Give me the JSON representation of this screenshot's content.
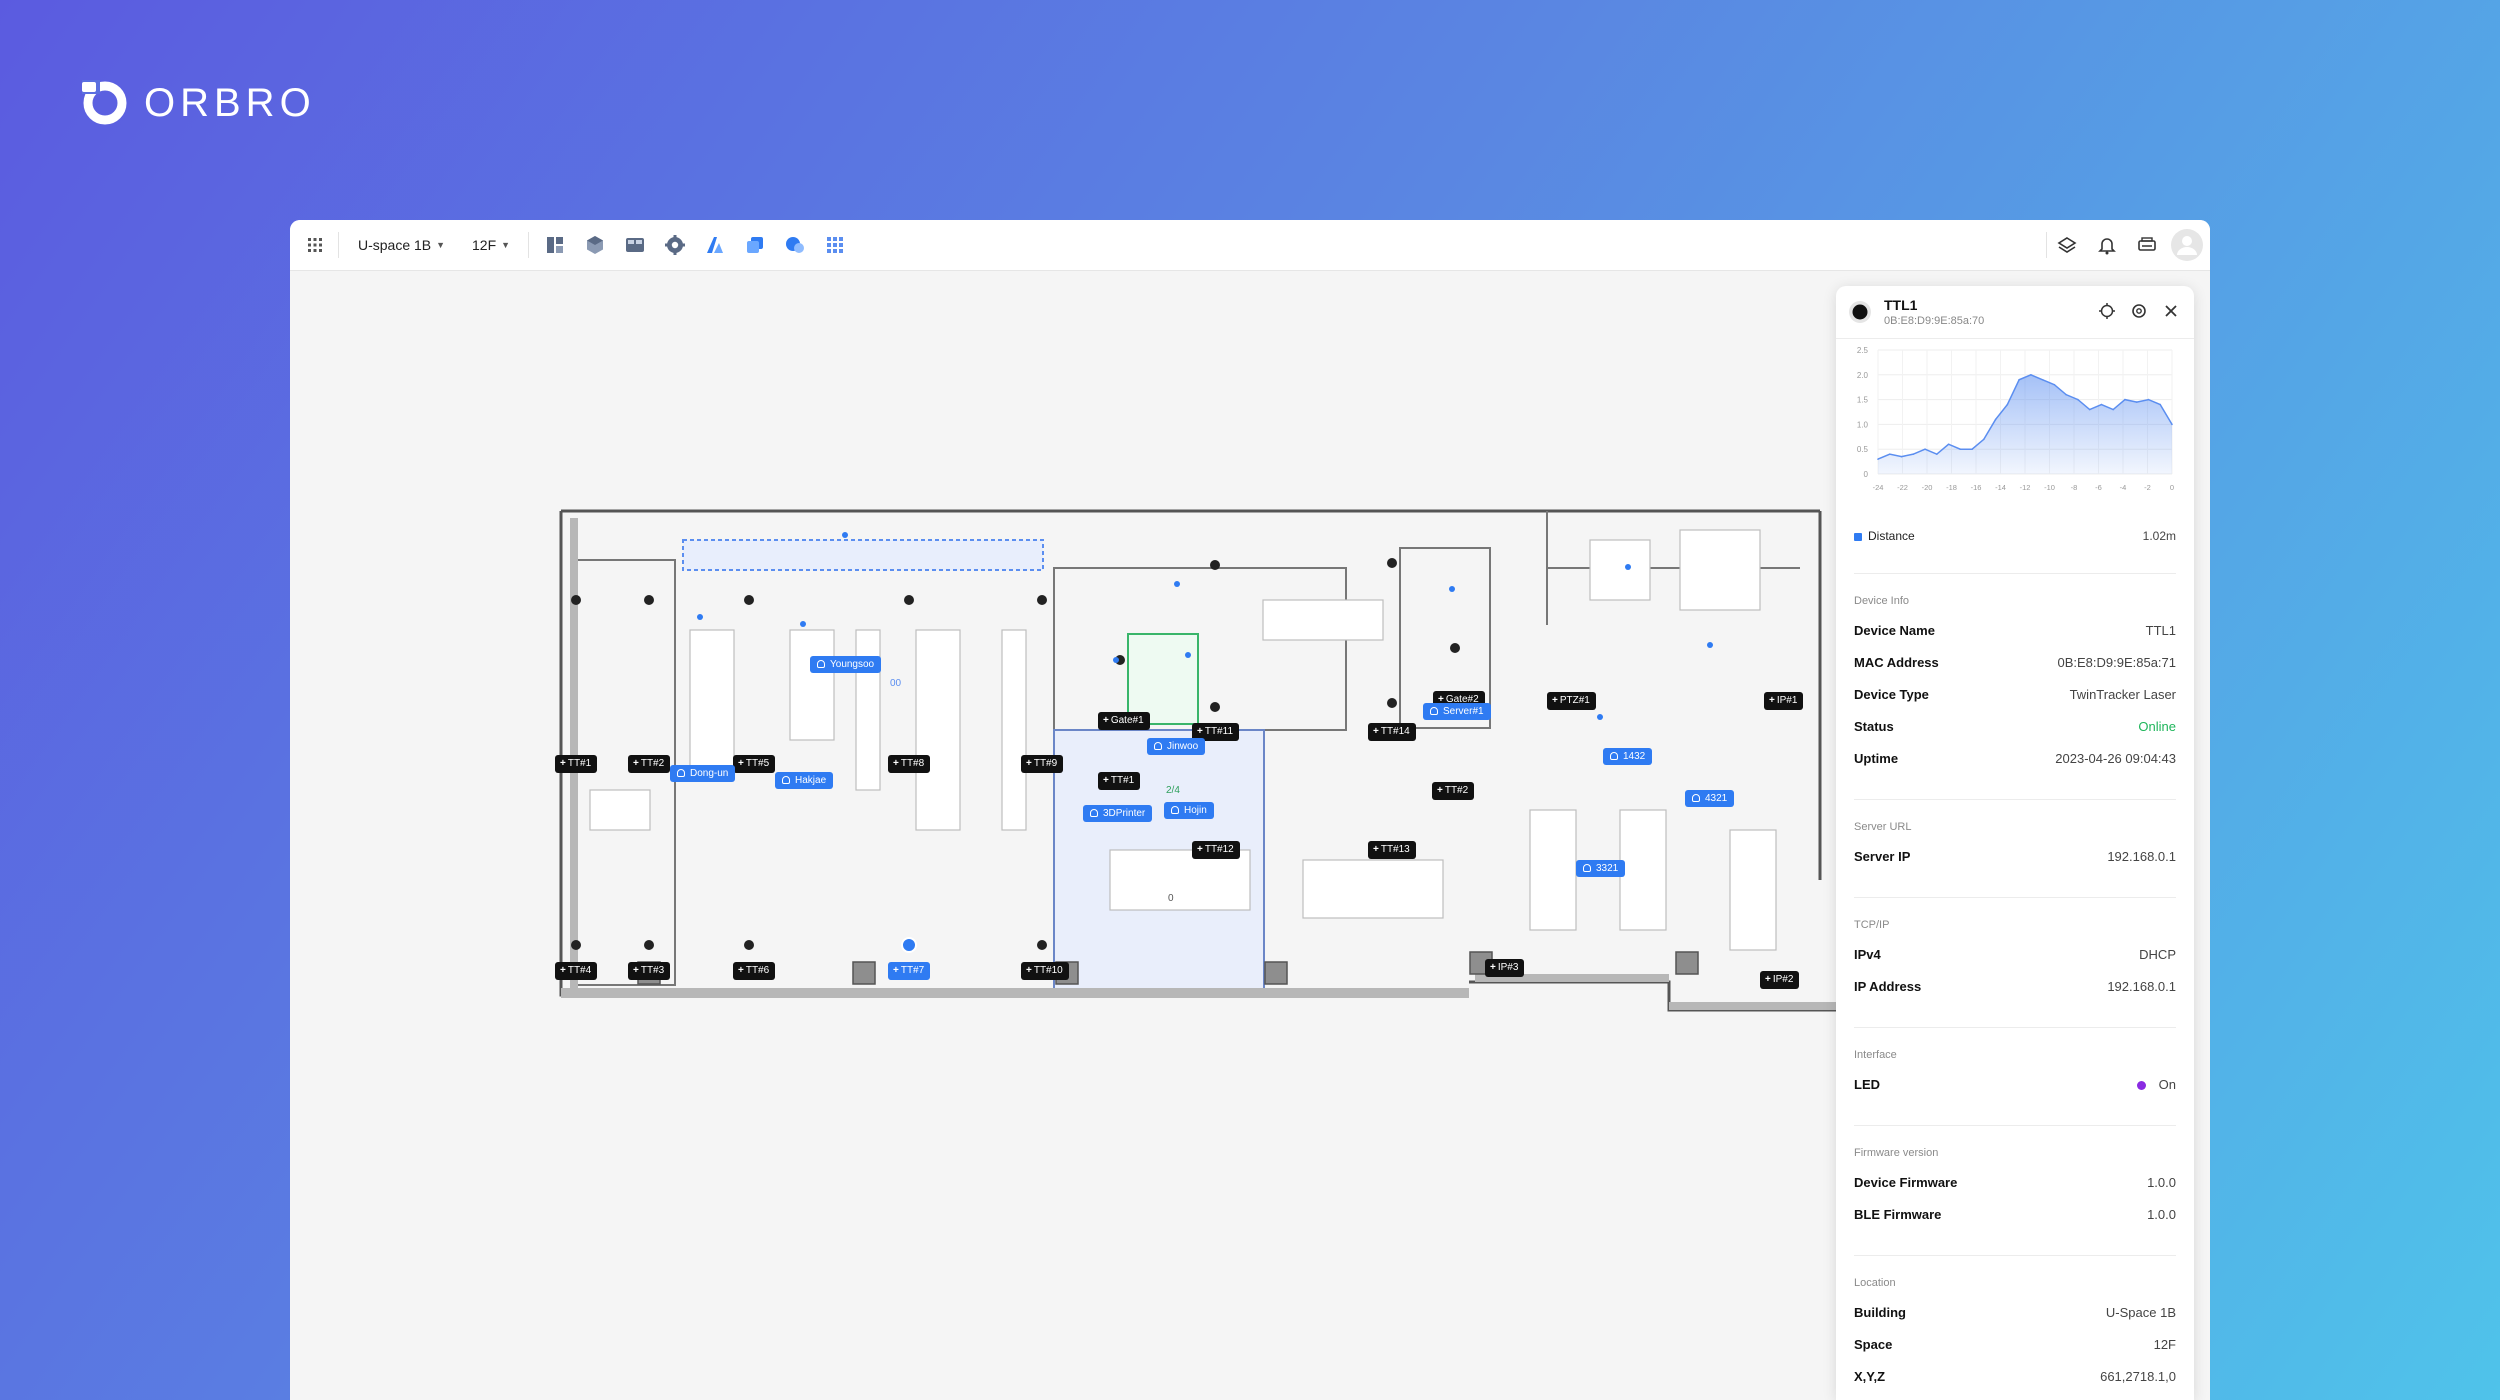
{
  "brand": {
    "name": "ORBRO"
  },
  "topbar": {
    "building": "U-space 1B",
    "floor": "12F",
    "tools": [
      "layout-icon",
      "cube-icon",
      "panels-icon",
      "gear-icon",
      "chart-icon",
      "layers-icon",
      "circles-icon",
      "grid-icon"
    ],
    "right": [
      "layers-stack-icon",
      "bell-icon",
      "print-icon",
      "avatar"
    ]
  },
  "map": {
    "device_tags": [
      "TT#1",
      "TT#2",
      "TT#5",
      "TT#8",
      "TT#9",
      "TT#4",
      "TT#3",
      "TT#6",
      "TT#7",
      "TT#10",
      "TT#1",
      "TT#11",
      "TT#12",
      "TT#13",
      "TT#14",
      "TT#2",
      "Gate#1",
      "Gate#2",
      "PTZ#1",
      "IP#1",
      "IP#2",
      "IP#3"
    ],
    "people": [
      "Youngsoo",
      "Dong-un",
      "Hakjae",
      "Jinwoo",
      "Hojin",
      "1432",
      "4321",
      "3321"
    ],
    "assets": [
      "3DPrinter",
      "Server#1"
    ],
    "zone_count": "2/4",
    "meeting_count": "0",
    "hall_count": "00"
  },
  "panel": {
    "device_title": "TTL1",
    "device_mac": "0B:E8:D9:9E:85a:70",
    "chart_data": {
      "type": "area",
      "series": [
        {
          "name": "Distance",
          "values": [
            0.3,
            0.4,
            0.35,
            0.4,
            0.5,
            0.4,
            0.6,
            0.5,
            0.5,
            0.7,
            1.1,
            1.4,
            1.9,
            2.0,
            1.9,
            1.8,
            1.6,
            1.5,
            1.3,
            1.4,
            1.3,
            1.5,
            1.45,
            1.5,
            1.4,
            1.0
          ]
        }
      ],
      "x_range": [
        -24,
        0
      ],
      "x_ticks": [
        "-24",
        "-22",
        "-20",
        "-18",
        "-16",
        "-14",
        "-12",
        "-10",
        "-8",
        "-6",
        "-4",
        "-2",
        "0"
      ],
      "y_ticks": [
        "0",
        "0.5",
        "1.0",
        "1.5",
        "2.0",
        "2.5"
      ],
      "ylim": [
        0,
        2.5
      ],
      "color": "#5b8ef0"
    },
    "legend": {
      "label": "Distance",
      "value": "1.02m",
      "color": "#2f7bf2"
    },
    "sections": [
      {
        "title": "Device Info",
        "rows": [
          {
            "k": "Device Name",
            "v": "TTL1"
          },
          {
            "k": "MAC Address",
            "v": "0B:E8:D9:9E:85a:71"
          },
          {
            "k": "Device Type",
            "v": "TwinTracker Laser"
          },
          {
            "k": "Status",
            "v": "Online"
          },
          {
            "k": "Uptime",
            "v": "2023-04-26 09:04:43"
          }
        ]
      },
      {
        "title": "Server URL",
        "rows": [
          {
            "k": "Server IP",
            "v": "192.168.0.1"
          }
        ]
      },
      {
        "title": "TCP/IP",
        "rows": [
          {
            "k": "IPv4",
            "v": "DHCP"
          },
          {
            "k": "IP Address",
            "v": "192.168.0.1"
          }
        ]
      },
      {
        "title": "Interface",
        "rows": [
          {
            "k": "LED",
            "v": "On"
          }
        ]
      },
      {
        "title": "Firmware version",
        "rows": [
          {
            "k": "Device Firmware",
            "v": "1.0.0"
          },
          {
            "k": "BLE Firmware",
            "v": "1.0.0"
          }
        ]
      },
      {
        "title": "Location",
        "rows": [
          {
            "k": "Building",
            "v": "U-Space 1B"
          },
          {
            "k": "Space",
            "v": "12F"
          },
          {
            "k": "X,Y,Z",
            "v": "661,2718.1,0"
          }
        ]
      }
    ],
    "status_color": "#1fb65b",
    "led_color": "#8a2be2"
  }
}
